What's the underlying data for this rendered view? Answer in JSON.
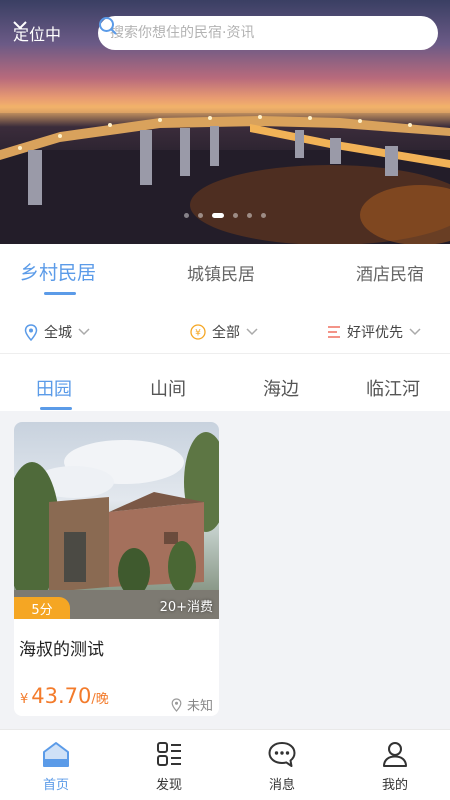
{
  "header": {
    "location_label": "定位中",
    "search_placeholder": "搜索你想住的民宿·资讯"
  },
  "banner": {
    "slide_count": 6,
    "active_index": 3
  },
  "category_tabs": [
    {
      "label": "乡村民居",
      "active": true
    },
    {
      "label": "城镇民居",
      "active": false
    },
    {
      "label": "酒店民宿",
      "active": false
    }
  ],
  "filters": {
    "area": "全城",
    "price": "全部",
    "sort": "好评优先"
  },
  "sub_tabs": [
    {
      "label": "田园",
      "active": true
    },
    {
      "label": "山间",
      "active": false
    },
    {
      "label": "海边",
      "active": false
    },
    {
      "label": "临江河",
      "active": false
    }
  ],
  "listing": {
    "title": "海叔的测试",
    "score": "5分",
    "sales": "20+消费",
    "currency": "¥",
    "price": "43.70",
    "unit": "/晚",
    "location": "未知"
  },
  "bottom_nav": [
    {
      "label": "首页",
      "icon": "home-icon",
      "active": true
    },
    {
      "label": "发现",
      "icon": "grid-list-icon",
      "active": false
    },
    {
      "label": "消息",
      "icon": "chat-bubble-icon",
      "active": false
    },
    {
      "label": "我的",
      "icon": "user-icon",
      "active": false
    }
  ],
  "colors": {
    "accent": "#5b9be8",
    "price": "#f37b2b",
    "score_badge": "#f5a623",
    "content_bg": "#f2f3f6"
  }
}
